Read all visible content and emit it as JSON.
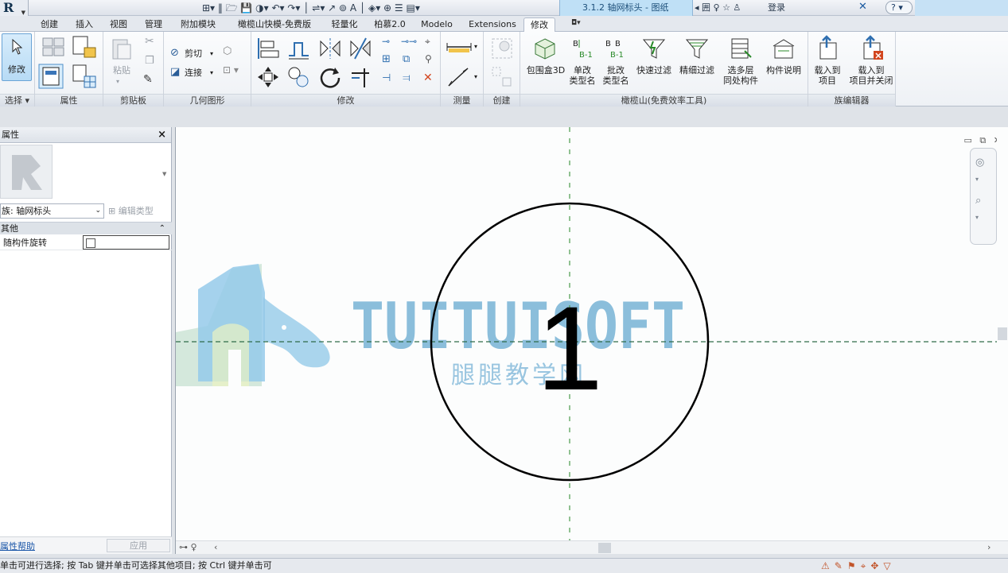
{
  "app": {
    "logo": "R",
    "document_title": "3.1.2 轴网标头 - 图纸"
  },
  "info_center": {
    "login": "登录",
    "help": "?"
  },
  "tabs": [
    "创建",
    "插入",
    "视图",
    "管理",
    "附加模块",
    "橄榄山快模-免费版",
    "轻量化",
    "柏慕2.0",
    "Modelo",
    "Extensions",
    "修改"
  ],
  "active_tab": "修改",
  "ribbon": {
    "panels": {
      "select": "选择",
      "properties": "属性",
      "clipboard": "剪贴板",
      "geometry": "几何图形",
      "modify": "修改",
      "measure": "测量",
      "create": "创建",
      "ganlanshan": "橄榄山(免费效率工具)",
      "family_editor": "族编辑器"
    },
    "modify_button": "修改",
    "paste": "粘贴",
    "cut": "剪切",
    "join": "连接",
    "buttons": [
      {
        "name": "bounding-box-3d",
        "label": "包围盒3D"
      },
      {
        "name": "rename-single",
        "label": "单改\n类型名"
      },
      {
        "name": "rename-batch",
        "label": "批改\n类型名"
      },
      {
        "name": "quick-filter",
        "label": "快速过滤"
      },
      {
        "name": "fine-filter",
        "label": "精细过滤"
      },
      {
        "name": "multi-layer",
        "label": "选多层\n同处构件"
      },
      {
        "name": "component-desc",
        "label": "构件说明"
      },
      {
        "name": "load-into-project",
        "label": "载入到\n项目"
      },
      {
        "name": "load-into-project-close",
        "label": "载入到\n项目并关闭"
      }
    ]
  },
  "properties": {
    "title": "属性",
    "family": "族: 轴网标头",
    "edit_type": "编辑类型",
    "section": "其他",
    "param_name": "随构件旋转",
    "param_checked": false,
    "help_link": "属性帮助",
    "apply": "应用"
  },
  "canvas": {
    "grid_number": "1",
    "watermark_en": "TUITUISOFT",
    "watermark_cn": "腿腿教学网",
    "colors": {
      "grid_line": "#4a9a4a",
      "circle": "#000000",
      "watermark": "#7fb8d8"
    }
  },
  "status": {
    "text": "单击可进行选择; 按 Tab 键并单击可选择其他项目; 按 Ctrl 键并单击可"
  }
}
